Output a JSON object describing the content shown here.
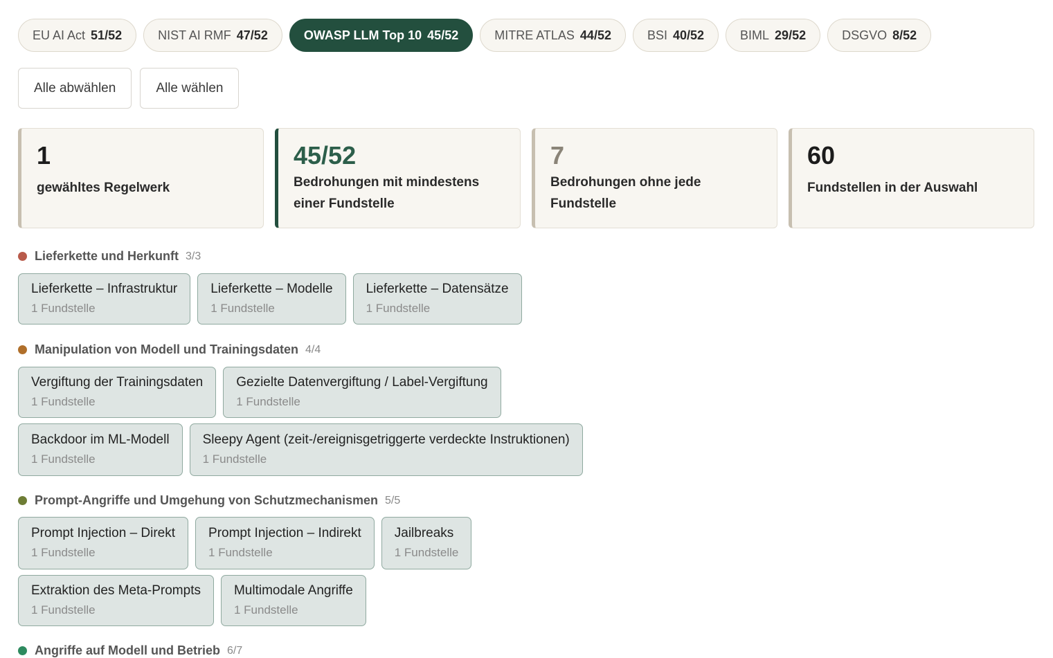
{
  "filters": [
    {
      "label": "EU AI Act",
      "count": "51/52"
    },
    {
      "label": "NIST AI RMF",
      "count": "47/52"
    },
    {
      "label": "OWASP LLM Top 10",
      "count": "45/52"
    },
    {
      "label": "MITRE ATLAS",
      "count": "44/52"
    },
    {
      "label": "BSI",
      "count": "40/52"
    },
    {
      "label": "BIML",
      "count": "29/52"
    },
    {
      "label": "DSGVO",
      "count": "8/52"
    }
  ],
  "active_filter": "OWASP LLM Top 10",
  "actions": {
    "deselect_all": "Alle abwählen",
    "select_all": "Alle wählen"
  },
  "stats": [
    {
      "value": "1",
      "label": "gewähltes Regelwerk"
    },
    {
      "value": "45/52",
      "label": "Bedrohungen mit mindestens einer Fundstelle"
    },
    {
      "value": "7",
      "label": "Bedrohungen ohne jede Fundstelle"
    },
    {
      "value": "60",
      "label": "Fundstellen in der Auswahl"
    }
  ],
  "groups": [
    {
      "title": "Lieferkette und Herkunft",
      "count": "3/3",
      "color": "#b85a4a",
      "items": [
        {
          "title": "Lieferkette – Infrastruktur",
          "sub": "1 Fundstelle"
        },
        {
          "title": "Lieferkette – Modelle",
          "sub": "1 Fundstelle"
        },
        {
          "title": "Lieferkette – Datensätze",
          "sub": "1 Fundstelle"
        }
      ]
    },
    {
      "title": "Manipulation von Modell und Trainingsdaten",
      "count": "4/4",
      "color": "#b06f2a",
      "items": [
        {
          "title": "Vergiftung der Trainingsdaten",
          "sub": "1 Fundstelle"
        },
        {
          "title": "Gezielte Datenvergiftung / Label-Vergiftung",
          "sub": "1 Fundstelle"
        },
        {
          "title": "Backdoor im ML-Modell",
          "sub": "1 Fundstelle"
        },
        {
          "title": "Sleepy Agent (zeit-/ereignisgetriggerte verdeckte Instruktionen)",
          "sub": "1 Fundstelle"
        }
      ]
    },
    {
      "title": "Prompt-Angriffe und Umgehung von Schutzmechanismen",
      "count": "5/5",
      "color": "#6e7d35",
      "items": [
        {
          "title": "Prompt Injection – Direkt",
          "sub": "1 Fundstelle"
        },
        {
          "title": "Prompt Injection – Indirekt",
          "sub": "1 Fundstelle"
        },
        {
          "title": "Jailbreaks",
          "sub": "1 Fundstelle"
        },
        {
          "title": "Extraktion des Meta-Prompts",
          "sub": "1 Fundstelle"
        },
        {
          "title": "Multimodale Angriffe",
          "sub": "1 Fundstelle"
        }
      ]
    },
    {
      "title": "Angriffe auf Modell und Betrieb",
      "count": "6/7",
      "color": "#2e8a5f",
      "items": []
    }
  ]
}
